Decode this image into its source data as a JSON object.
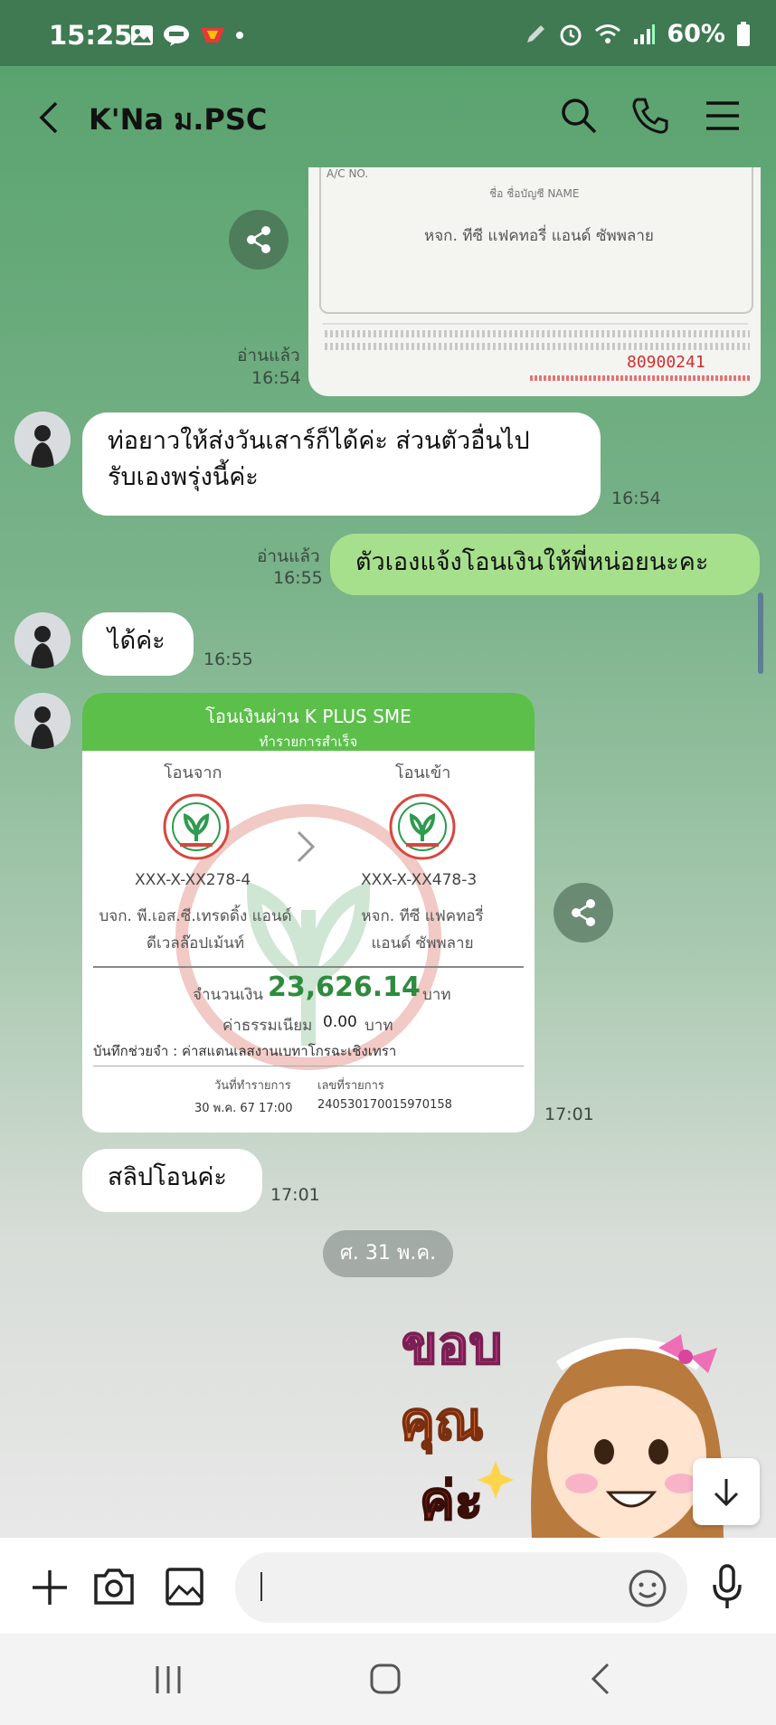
{
  "status_bar": {
    "time": "15:25",
    "battery": "60%"
  },
  "header": {
    "title": "K'Na ม.PSC"
  },
  "messages": {
    "m1": {
      "read": "อ่านแล้ว",
      "time": "16:54"
    },
    "m2": {
      "text": "ท่อยาวให้ส่งวันเสาร์ก็ได้ค่ะ ส่วนตัวอื่นไป\nรับเองพรุ่งนี้ค่ะ",
      "time": "16:54"
    },
    "m3": {
      "read": "อ่านแล้ว",
      "time": "16:55",
      "text": "ตัวเองแจ้งโอนเงินให้พี่หน่อยนะคะ"
    },
    "m4": {
      "text": "ได้ค่ะ",
      "time": "16:55"
    },
    "m5": {
      "time": "17:01"
    },
    "m6": {
      "text": "สลิปโอนค่ะ",
      "time": "17:01"
    }
  },
  "doc_image": {
    "ac_no": "A/C NO.",
    "name_label": "ชื่อ ชื่อบัญชี NAME",
    "name_value": "หจก. ทีซี แฟคทอรี่ แอนด์ ซัพพลาย",
    "number": "80900241"
  },
  "slip": {
    "title": "โอนเงินผ่าน K PLUS SME",
    "subtitle": "ทำรายการสำเร็จ",
    "from_label": "โอนจาก",
    "to_label": "โอนเข้า",
    "from_account": "XXX-X-XX278-4",
    "to_account": "XXX-X-XX478-3",
    "from_name": "บจก. พี.เอส.ซี.เทรดดิ้ง แอนด์\nดีเวลล๊อปเม้นท์",
    "to_name": "หจก. ทีซี แฟคทอรี่\nแอนด์ ซัพพลาย",
    "amount_label": "จำนวนเงิน",
    "amount": "23,626.14",
    "currency": "บาท",
    "fee_label": "ค่าธรรมเนียม",
    "fee": "0.00",
    "fee_currency": "บาท",
    "memo": "บันทึกช่วยจำ : ค่าสแตนเลสงานเบทาโกรฉะเชิงเทรา",
    "date_label": "วันที่ทำรายการ",
    "date": "30 พ.ค. 67 17:00",
    "ref_label": "เลขที่รายการ",
    "ref": "240530170015970158"
  },
  "date_divider": "ศ. 31 พ.ค.",
  "sticker": {
    "line1": "ขอบ",
    "line2": "คุณ",
    "line3": "ค่ะ"
  },
  "colors": {
    "status_bar": "#3f7a52",
    "out_bubble": "#a6e08c",
    "slip_green": "#5bbf4a"
  }
}
